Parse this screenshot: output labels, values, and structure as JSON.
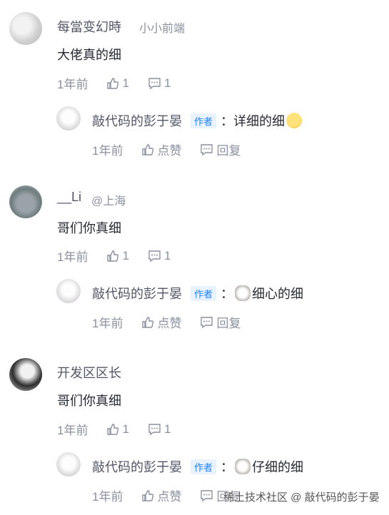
{
  "comments": [
    {
      "user": "每當变幻時",
      "tag": "小小前端",
      "text": "大佬真的细",
      "time": "1年前",
      "likes": "1",
      "replies_count": "1",
      "reply": {
        "user": "敲代码的彭于晏",
        "author_label": "作者",
        "text": "：详细的细",
        "emoji": "thinking-face-emoji",
        "time": "1年前",
        "like_label": "点赞",
        "reply_label": "回复"
      }
    },
    {
      "user": "__Li",
      "tag": "@上海",
      "text": "哥们你真细",
      "time": "1年前",
      "likes": "1",
      "replies_count": "1",
      "reply": {
        "user": "敲代码的彭于晏",
        "author_label": "作者",
        "text": "细心的细",
        "prefix": "：",
        "emoji": "cat-face-emoji",
        "time": "1年前",
        "like_label": "点赞",
        "reply_label": "回复"
      }
    },
    {
      "user": "开发区区长",
      "tag": "",
      "text": "哥们你真细",
      "time": "1年前",
      "likes": "1",
      "replies_count": "1",
      "reply": {
        "user": "敲代码的彭于晏",
        "author_label": "作者",
        "text": "仔细的细",
        "prefix": "：",
        "emoji": "cat-face-emoji",
        "time": "1年前",
        "like_label": "点赞",
        "reply_label": "回复"
      }
    }
  ],
  "watermark": "稀土技术社区 @ 敲代码的彭于晏",
  "colors": {
    "text": "#252933",
    "muted": "#8a919f",
    "author_tag_text": "#1e80ff",
    "author_tag_bg": "#e8f3ff"
  }
}
